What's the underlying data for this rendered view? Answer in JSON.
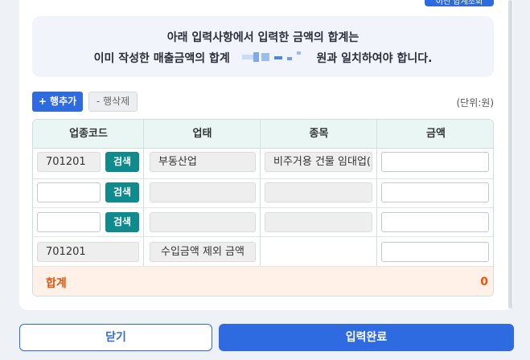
{
  "header": {
    "top_button_label": "이전 합계조회"
  },
  "notice": {
    "line1": "아래 입력사항에서 입력한 금액의 합계는",
    "line2_prefix": "이미 작성한 매출금액의 합계",
    "line2_suffix": "원과 일치하여야 합니다."
  },
  "toolbar": {
    "add_row_label": "+ 행추가",
    "delete_row_label": "- 행삭제",
    "unit_label": "(단위:원)"
  },
  "table": {
    "headers": [
      "업종코드",
      "업태",
      "종목",
      "금액"
    ],
    "search_label": "검색",
    "rows": [
      {
        "code": "701201",
        "business_type": "부동산업",
        "item": "비주거용 건물 임대업(",
        "amount": ""
      },
      {
        "code": "",
        "business_type": "",
        "item": "",
        "amount": ""
      },
      {
        "code": "",
        "business_type": "",
        "item": "",
        "amount": ""
      },
      {
        "code": "701201",
        "business_type": "수입금액 제외 금액",
        "item": "",
        "amount": ""
      }
    ],
    "total_label": "합계",
    "total_value": "0"
  },
  "footer": {
    "close_label": "닫기",
    "complete_label": "입력완료"
  },
  "colors": {
    "primary": "#2f6be0",
    "search": "#0f8b8d",
    "total": "#e8550d"
  }
}
